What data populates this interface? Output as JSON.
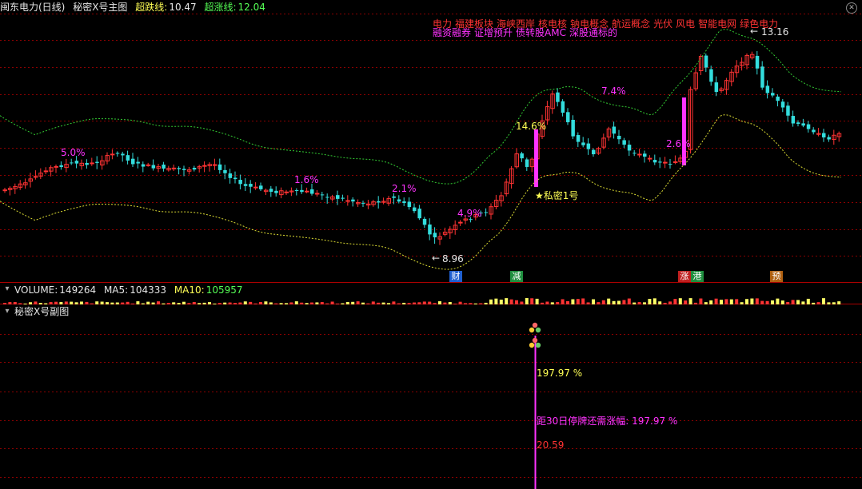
{
  "main_header": {
    "title": "闽东电力(日线)",
    "indicator_name": "秘密X号主图",
    "low_line_label": "超跌线:",
    "low_line_value": "10.47",
    "high_line_label": "超涨线:",
    "high_line_value": "12.04"
  },
  "concepts": {
    "line1": [
      "电力",
      "福建板块",
      "海峡西岸",
      "核电核",
      "钠电概念",
      "航运概念",
      "光伏",
      "风电",
      "智能电网",
      "绿色电力"
    ],
    "line2": [
      "融资融券",
      "证增预升",
      "债转股AMC",
      "深股通标的"
    ]
  },
  "price_labels": {
    "high_price": "13.16",
    "low_price": "8.96",
    "star_signal": "★私密1号"
  },
  "pct_labels": [
    "5.0%",
    "1.6%",
    "2.1%",
    "4.9%",
    "14.6%",
    "7.4%",
    "2.6%"
  ],
  "event_markers": [
    {
      "text": "财",
      "color": "#1f5fcf"
    },
    {
      "text": "减",
      "color": "#1f8f3f"
    },
    {
      "text": "涨",
      "color": "#c02020"
    },
    {
      "text": "港",
      "color": "#1f8f3f"
    },
    {
      "text": "预",
      "color": "#b06010"
    }
  ],
  "volume_header": {
    "label": "VOLUME:",
    "value": "149264",
    "ma5_label": "MA5:",
    "ma5_value": "104333",
    "ma10_label": "MA10:",
    "ma10_value": "105957"
  },
  "sub_header": {
    "title": "秘密X号副图"
  },
  "sub_labels": {
    "pct_value": "197.97 %",
    "gap_text": "距30日停牌还需涨幅: 197.97 %",
    "price_value": "20.59"
  },
  "colors": {
    "up": "#ff3333",
    "down": "#33dddd",
    "grid": "#8b0000",
    "upper_band": "#33cc33",
    "lower_band": "#dddd33",
    "magenta": "#ff33ff"
  }
}
